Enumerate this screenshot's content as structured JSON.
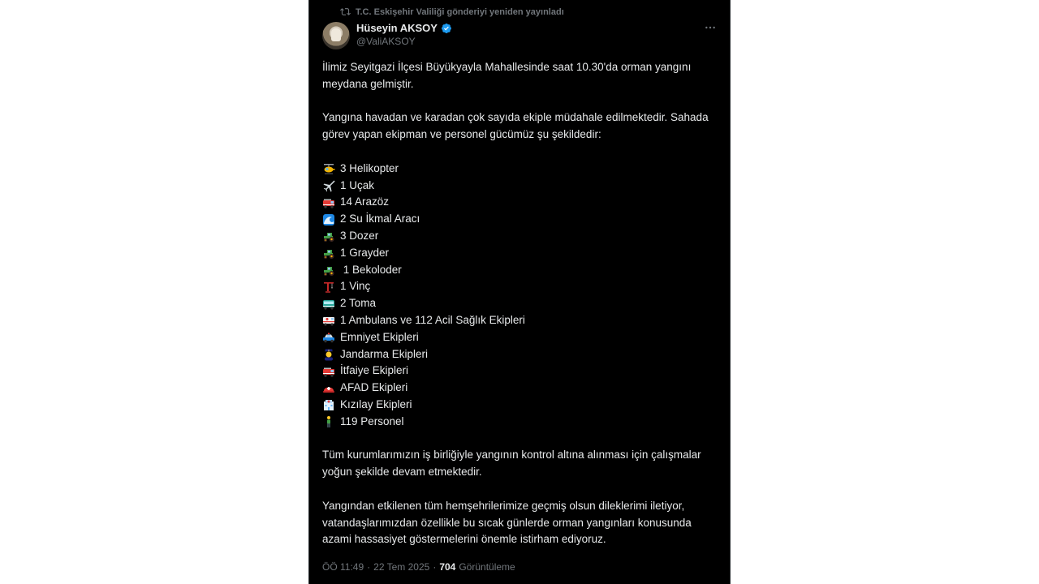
{
  "repost": {
    "text": "T.C. Eskişehir Valiliği gönderiyi yeniden yayınladı",
    "icon": "repost-icon"
  },
  "author": {
    "name": "Hüseyin AKSOY",
    "handle": "@ValiAKSOY",
    "verified_color": "#1d9bf0"
  },
  "tweet": {
    "p1": "İlimiz Seyitgazi İlçesi Büyükyayla Mahallesinde saat 10.30'da orman yangını meydana gelmiştir.",
    "p2": "Yangına havadan ve karadan çok sayıda ekiple müdahale edilmektedir. Sahada görev yapan ekipman ve personel gücümüz şu şekildedir:",
    "items": [
      {
        "icon": "helicopter-icon",
        "text": "3 Helikopter"
      },
      {
        "icon": "airplane-icon",
        "text": "1 Uçak"
      },
      {
        "icon": "fire-engine-icon",
        "text": "14 Arazöz"
      },
      {
        "icon": "water-wave-icon",
        "text": "2 Su İkmal Aracı"
      },
      {
        "icon": "tractor-icon",
        "text": "3 Dozer"
      },
      {
        "icon": "tractor-icon",
        "text": "1 Grayder"
      },
      {
        "icon": "tractor-icon",
        "text": " 1 Bekoloder"
      },
      {
        "icon": "crane-icon",
        "text": "1 Vinç"
      },
      {
        "icon": "bus-icon",
        "text": "2 Toma"
      },
      {
        "icon": "ambulance-icon",
        "text": "1 Ambulans ve 112 Acil Sağlık Ekipleri"
      },
      {
        "icon": "police-car-icon",
        "text": "Emniyet Ekipleri"
      },
      {
        "icon": "police-officer-icon",
        "text": "Jandarma Ekipleri"
      },
      {
        "icon": "fire-engine-icon",
        "text": "İtfaiye Ekipleri"
      },
      {
        "icon": "rescue-helmet-icon",
        "text": "AFAD Ekipleri"
      },
      {
        "icon": "hospital-icon",
        "text": "Kızılay Ekipleri"
      },
      {
        "icon": "person-standing-icon",
        "text": "119 Personel"
      }
    ],
    "p3": "Tüm kurumlarımızın iş birliğiyle yangının kontrol altına alınması için çalışmalar yoğun şekilde devam etmektedir.",
    "p4": "Yangından etkilenen tüm hemşehrilerimize geçmiş olsun dileklerimi iletiyor, vatandaşlarımızdan özellikle bu sıcak günlerde orman yangınları konusunda azami hassasiyet göstermelerini önemle istirham ediyoruz."
  },
  "meta": {
    "time": "ÖÖ 11:49",
    "date": "22 Tem 2025",
    "views_count": "704",
    "views_label": "Görüntüleme"
  }
}
